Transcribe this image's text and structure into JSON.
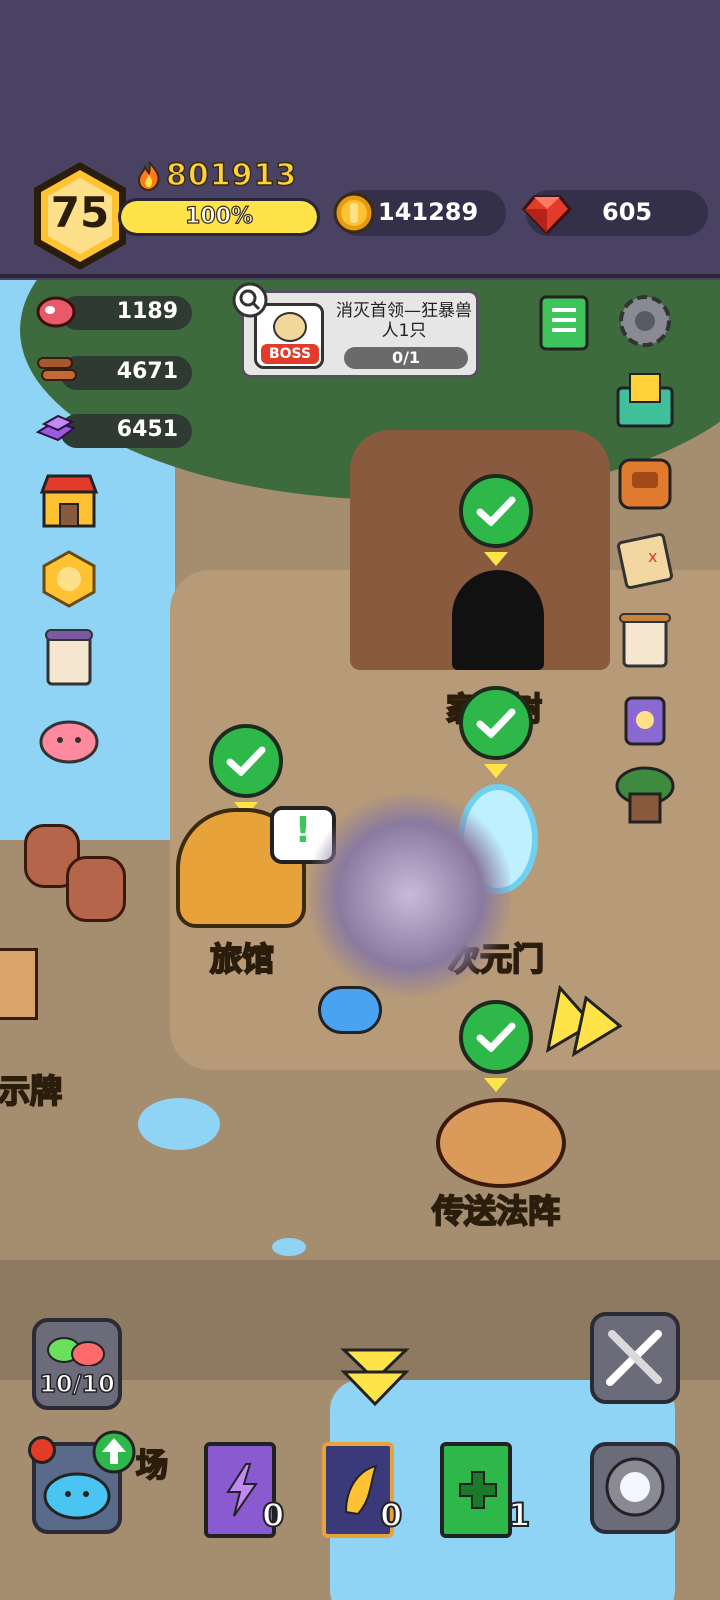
{
  "player": {
    "level": "75",
    "power": "801913",
    "xp_label": "100%",
    "xp_fraction": 1.0
  },
  "currencies": {
    "coins": "141289",
    "gems": "605"
  },
  "resources": {
    "meat": "1189",
    "wood": "4671",
    "crystal": "6451"
  },
  "quest": {
    "badge": "BOSS",
    "text": "消灭首领—狂暴兽人1只",
    "progress": "0/1"
  },
  "buildings": {
    "tree": "家园树",
    "inn": "旅馆",
    "portal": "次元门",
    "teleport": "传送法阵",
    "sign": "告示牌",
    "farm": "场"
  },
  "bottom": {
    "slime_count": "10/10",
    "book_purple_count": "0",
    "book_gold_count": "0",
    "book_green_count": "1"
  },
  "colors": {
    "header_bg": "#4a4262",
    "accent_gold": "#ffd23a",
    "check_green": "#2eb84a",
    "water": "#8fd3f5"
  },
  "icons": {
    "left_column": [
      "shop-icon",
      "rank-badge-icon",
      "calendar-scroll-icon",
      "pet-slime-icon"
    ],
    "right_column": [
      "guide-book-icon",
      "settings-gear-icon",
      "mail-icon",
      "backpack-icon",
      "treasure-map-icon",
      "notice-scroll-icon",
      "skull-potion-icon",
      "tree-house-icon"
    ]
  }
}
